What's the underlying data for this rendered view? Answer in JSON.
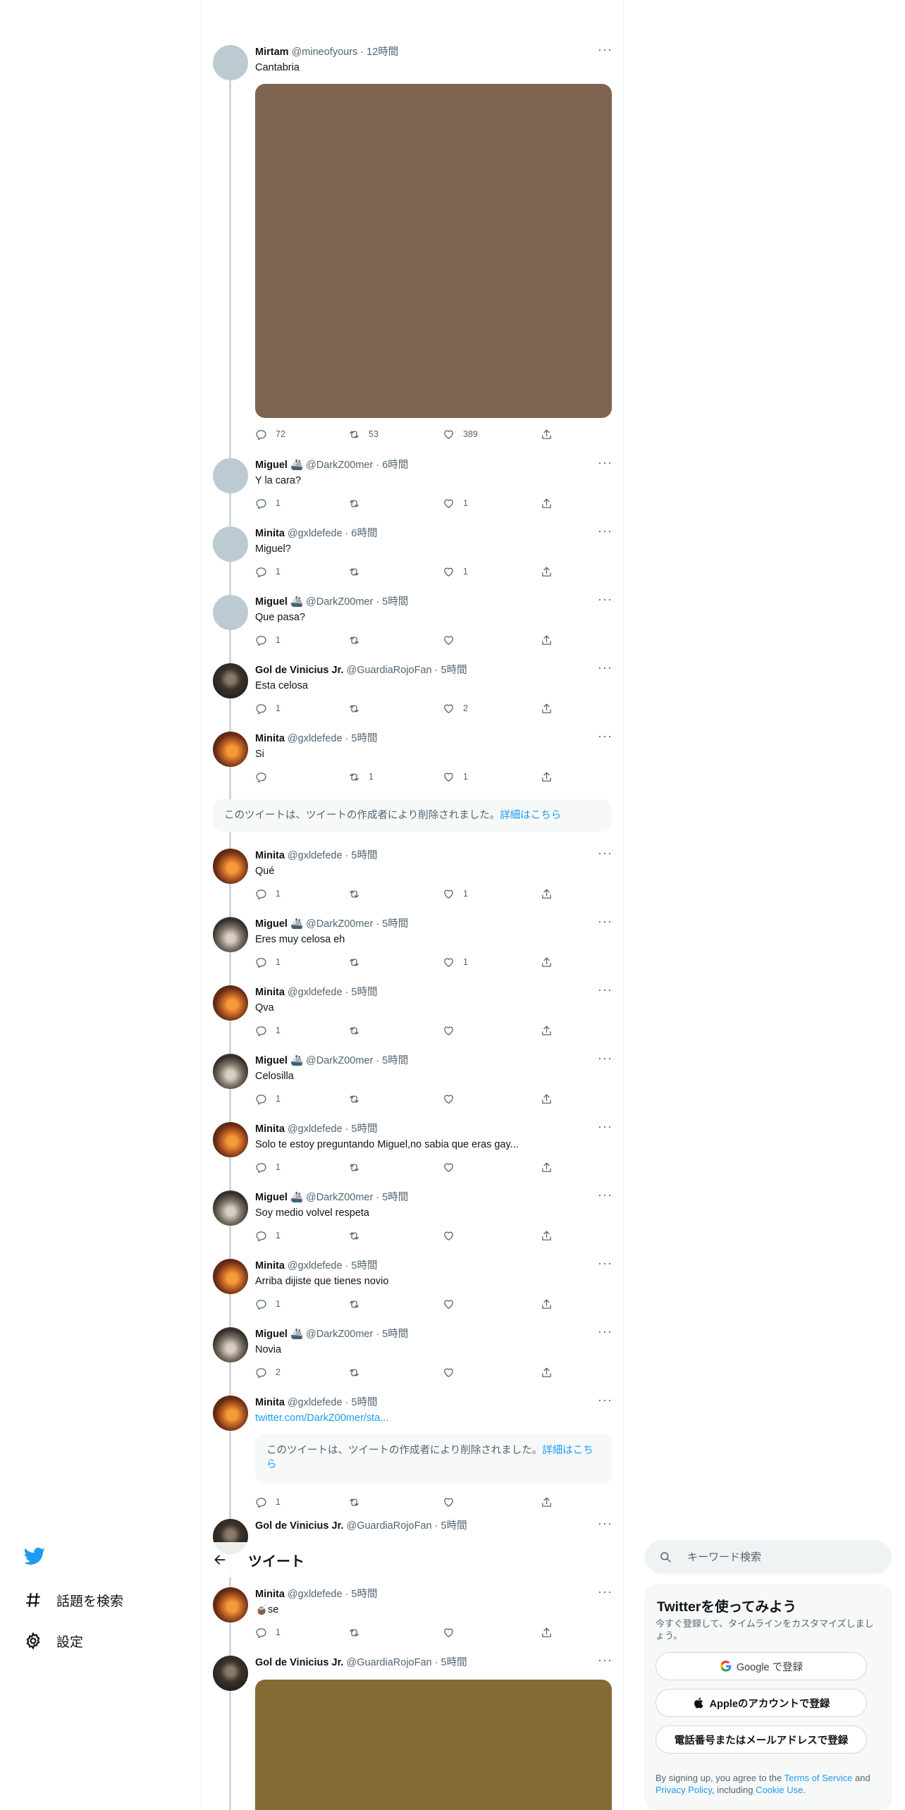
{
  "thread": {
    "tweets": [
      {
        "name": "Mirtam",
        "handle": "@mineofyours",
        "time": "12時間",
        "text": "Cantabria",
        "replies": "72",
        "retweets": "53",
        "likes": "389"
      },
      {
        "name": "Miguel 🚢",
        "handle": "@DarkZ00mer",
        "time": "6時間",
        "text": "Y la cara?",
        "replies": "1",
        "retweets": "",
        "likes": "1"
      },
      {
        "name": "Minita",
        "handle": "@gxldefede",
        "time": "6時間",
        "text": "Miguel?",
        "replies": "1",
        "retweets": "",
        "likes": "1"
      },
      {
        "name": "Miguel 🚢",
        "handle": "@DarkZ00mer",
        "time": "5時間",
        "text": "Que pasa?",
        "replies": "1",
        "retweets": "",
        "likes": ""
      },
      {
        "name": "Gol de Vinicius Jr.",
        "handle": "@GuardiaRojoFan",
        "time": "5時間",
        "text": "Esta celosa",
        "replies": "1",
        "retweets": "",
        "likes": "2"
      },
      {
        "name": "Minita",
        "handle": "@gxldefede",
        "time": "5時間",
        "text": "Si",
        "replies": "",
        "retweets": "1",
        "likes": "1"
      },
      {
        "name": "Minita",
        "handle": "@gxldefede",
        "time": "5時間",
        "text": "Qué",
        "replies": "1",
        "retweets": "",
        "likes": "1"
      },
      {
        "name": "Miguel 🚢",
        "handle": "@DarkZ00mer",
        "time": "5時間",
        "text": "Eres muy celosa eh",
        "replies": "1",
        "retweets": "",
        "likes": "1"
      },
      {
        "name": "Minita",
        "handle": "@gxldefede",
        "time": "5時間",
        "text": "Qva",
        "replies": "1",
        "retweets": "",
        "likes": ""
      },
      {
        "name": "Miguel 🚢",
        "handle": "@DarkZ00mer",
        "time": "5時間",
        "text": "Celosilla",
        "replies": "1",
        "retweets": "",
        "likes": ""
      },
      {
        "name": "Minita",
        "handle": "@gxldefede",
        "time": "5時間",
        "text": "Solo te estoy preguntando Miguel,no sabia que eras gay...",
        "replies": "1",
        "retweets": "",
        "likes": ""
      },
      {
        "name": "Miguel 🚢",
        "handle": "@DarkZ00mer",
        "time": "5時間",
        "text": "Soy medio volvel respeta",
        "replies": "1",
        "retweets": "",
        "likes": ""
      },
      {
        "name": "Minita",
        "handle": "@gxldefede",
        "time": "5時間",
        "text": "Arriba dijiste que tienes novio",
        "replies": "1",
        "retweets": "",
        "likes": ""
      },
      {
        "name": "Miguel 🚢",
        "handle": "@DarkZ00mer",
        "time": "5時間",
        "text": "Novia",
        "replies": "2",
        "retweets": "",
        "likes": ""
      },
      {
        "name": "Minita",
        "handle": "@gxldefede",
        "time": "5時間",
        "text": "twitter.com/DarkZ00mer/sta...",
        "replies": "1",
        "retweets": "",
        "likes": ""
      },
      {
        "name": "Gol de Vinicius Jr.",
        "handle": "@GuardiaRojoFan",
        "time": "5時間",
        "text": ""
      },
      {
        "name": "Minita",
        "handle": "@gxldefede",
        "time": "5時間",
        "text": "🧉se",
        "replies": "1",
        "retweets": "",
        "likes": ""
      },
      {
        "name": "Gol de Vinicius Jr.",
        "handle": "@GuardiaRojoFan",
        "time": "5時間",
        "text": ""
      }
    ],
    "deleted_notice": "このツイートは、ツイートの作成者により削除されました。",
    "deleted_link": "詳細はこちら",
    "quoted_deleted_notice": "このツイートは、ツイートの作成者により削除されました。",
    "quoted_deleted_link": "詳細はこちら"
  },
  "header": {
    "title": "ツイート"
  },
  "nav": {
    "explore": "話題を検索",
    "settings": "設定"
  },
  "search": {
    "placeholder": "キーワード検索"
  },
  "signup": {
    "title": "Twitterを使ってみよう",
    "subtitle": "今すぐ登録して、タイムラインをカスタマイズしましょう。",
    "google": "Google で登録",
    "apple": "Appleのアカウントで登録",
    "phone": "電話番号またはメールアドレスで登録",
    "terms_1": "By signing up, you agree to the ",
    "terms_link": "Terms of Service",
    "terms_2": " and ",
    "privacy_link": "Privacy Policy",
    "terms_3": ", including ",
    "cookie_link": "Cookie Use",
    "terms_4": "."
  },
  "colors": {
    "accent": "#1d9bf0",
    "text": "#0f1419",
    "muted": "#536471",
    "media1": "#7e6450",
    "media2": "#846b35"
  }
}
